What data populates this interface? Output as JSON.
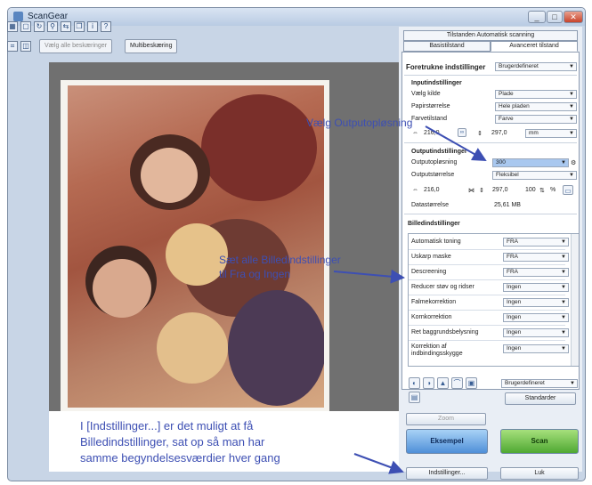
{
  "window": {
    "title": "ScanGear",
    "controls": [
      "_",
      "□",
      "✕"
    ]
  },
  "toolbar": {
    "select_all_crops": "Vælg alle beskæringer",
    "multi_crop": "Multibeskæring"
  },
  "tabs": {
    "auto_scan": "Tilstanden Automatisk scanning",
    "basic": "Basistilstand",
    "advanced": "Avanceret tilstand"
  },
  "favorites": {
    "label": "Foretrukne indstillinger",
    "value": "Brugerdefineret"
  },
  "input_settings": {
    "title": "Inputindstillinger",
    "select_source_label": "Vælg kilde",
    "select_source_value": "Plade",
    "paper_size_label": "Papirstørrelse",
    "paper_size_value": "Hele pladen",
    "color_mode_label": "Farvetilstand",
    "color_mode_value": "Farve",
    "width": "216,0",
    "height": "297,0",
    "unit": "mm"
  },
  "output_settings": {
    "title": "Outputindstillinger",
    "resolution_label": "Outputopløsning",
    "resolution_value": "300",
    "size_label": "Outputstørrelse",
    "size_value": "Fleksibel",
    "width": "216,0",
    "height": "297,0",
    "scale": "100",
    "scale_unit": "%",
    "data_size_label": "Datastørrelse",
    "data_size_value": "25,61 MB"
  },
  "image_settings": {
    "title": "Billedindstillinger",
    "rows": [
      {
        "label": "Automatisk toning",
        "value": "FRA"
      },
      {
        "label": "Uskarp maske",
        "value": "FRA"
      },
      {
        "label": "Descreening",
        "value": "FRA"
      },
      {
        "label": "Reducer støv og ridser",
        "value": "Ingen"
      },
      {
        "label": "Falmekorrektion",
        "value": "Ingen"
      },
      {
        "label": "Kornkorrektion",
        "value": "Ingen"
      },
      {
        "label": "Ret baggrundsbelysning",
        "value": "Ingen"
      },
      {
        "label": "Korrektion af indbindingsskygge",
        "value": "Ingen"
      }
    ]
  },
  "bottom_panel": {
    "preset_value": "Brugerdefineret",
    "defaults_button": "Standarder",
    "zoom_button": "Zoom",
    "preview_button": "Eksempel",
    "scan_button": "Scan",
    "settings_button": "Indstillinger...",
    "close_button": "Luk"
  },
  "annotations": {
    "output_resolution": "Vælg Outputopløsning",
    "image_settings_line1": "Sæt alle Billedindstillinger",
    "image_settings_line2": "til Fra og Ingen",
    "note_line1": "I [Indstillinger...] er det muligt at få",
    "note_line2": "Billedindstillinger, sat op så man har",
    "note_line3": "samme begyndelsesværdier hver gang"
  },
  "colors": {
    "annotation": "#3d4fb3",
    "preview_button": "#4f8fd8",
    "scan_button": "#4fa832"
  }
}
